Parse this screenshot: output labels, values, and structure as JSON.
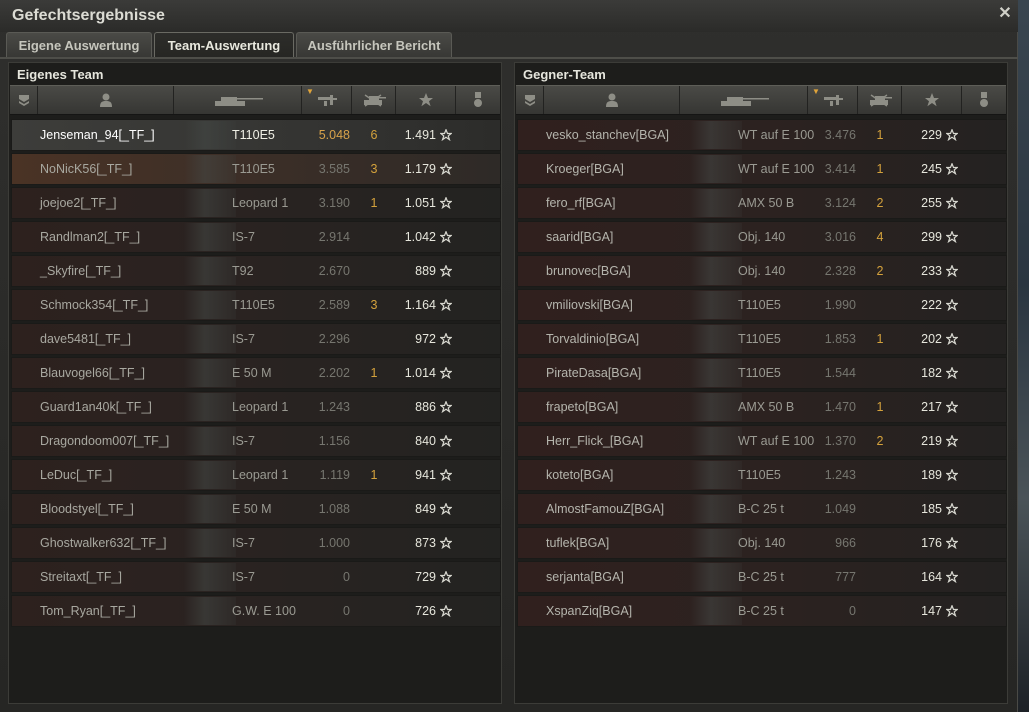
{
  "window": {
    "title": "Gefechtsergebnisse"
  },
  "tabs": [
    {
      "label": "Eigene Auswertung",
      "active": false
    },
    {
      "label": "Team-Auswertung",
      "active": true
    },
    {
      "label": "Ausführlicher Bericht",
      "active": false
    }
  ],
  "own_team": {
    "title": "Eigenes Team",
    "columns": [
      "squad-icon",
      "player-icon",
      "tank-icon",
      "xp-icon",
      "kills-icon",
      "star-icon",
      "medal-icon"
    ],
    "rows": [
      {
        "player": "Jenseman_94[_TF_]",
        "tank": "T110E5",
        "xp": "5.048",
        "kills": "6",
        "score": "1.491",
        "type": "self"
      },
      {
        "player": "NoNicK56[_TF_]",
        "tank": "T110E5",
        "xp": "3.585",
        "kills": "3",
        "score": "1.179",
        "type": "ally"
      },
      {
        "player": "joejoe2[_TF_]",
        "tank": "Leopard 1",
        "xp": "3.190",
        "kills": "1",
        "score": "1.051",
        "type": "normal"
      },
      {
        "player": "Randlman2[_TF_]",
        "tank": "IS-7",
        "xp": "2.914",
        "kills": "",
        "score": "1.042",
        "type": "normal"
      },
      {
        "player": "_Skyfire[_TF_]",
        "tank": "T92",
        "xp": "2.670",
        "kills": "",
        "score": "889",
        "type": "normal"
      },
      {
        "player": "Schmock354[_TF_]",
        "tank": "T110E5",
        "xp": "2.589",
        "kills": "3",
        "score": "1.164",
        "type": "normal"
      },
      {
        "player": "dave5481[_TF_]",
        "tank": "IS-7",
        "xp": "2.296",
        "kills": "",
        "score": "972",
        "type": "normal"
      },
      {
        "player": "Blauvogel66[_TF_]",
        "tank": "E 50 M",
        "xp": "2.202",
        "kills": "1",
        "score": "1.014",
        "type": "normal"
      },
      {
        "player": "Guard1an40k[_TF_]",
        "tank": "Leopard 1",
        "xp": "1.243",
        "kills": "",
        "score": "886",
        "type": "normal"
      },
      {
        "player": "Dragondoom007[_TF_]",
        "tank": "IS-7",
        "xp": "1.156",
        "kills": "",
        "score": "840",
        "type": "normal"
      },
      {
        "player": "LeDuc[_TF_]",
        "tank": "Leopard 1",
        "xp": "1.119",
        "kills": "1",
        "score": "941",
        "type": "normal"
      },
      {
        "player": "Bloodstyel[_TF_]",
        "tank": "E 50 M",
        "xp": "1.088",
        "kills": "",
        "score": "849",
        "type": "normal"
      },
      {
        "player": "Ghostwalker632[_TF_]",
        "tank": "IS-7",
        "xp": "1.000",
        "kills": "",
        "score": "873",
        "type": "normal"
      },
      {
        "player": "Streitaxt[_TF_]",
        "tank": "IS-7",
        "xp": "0",
        "kills": "",
        "score": "729",
        "type": "normal"
      },
      {
        "player": "Tom_Ryan[_TF_]",
        "tank": "G.W. E 100",
        "xp": "0",
        "kills": "",
        "score": "726",
        "type": "normal"
      }
    ]
  },
  "enemy_team": {
    "title": "Gegner-Team",
    "rows": [
      {
        "player": "vesko_stanchev[BGA]",
        "tank": "WT auf E 100",
        "xp": "3.476",
        "kills": "1",
        "score": "229"
      },
      {
        "player": "Kroeger[BGA]",
        "tank": "WT auf E 100",
        "xp": "3.414",
        "kills": "1",
        "score": "245"
      },
      {
        "player": "fero_rf[BGA]",
        "tank": "AMX 50 B",
        "xp": "3.124",
        "kills": "2",
        "score": "255"
      },
      {
        "player": "saarid[BGA]",
        "tank": "Obj. 140",
        "xp": "3.016",
        "kills": "4",
        "score": "299"
      },
      {
        "player": "brunovec[BGA]",
        "tank": "Obj. 140",
        "xp": "2.328",
        "kills": "2",
        "score": "233"
      },
      {
        "player": "vmiliovski[BGA]",
        "tank": "T110E5",
        "xp": "1.990",
        "kills": "",
        "score": "222"
      },
      {
        "player": "Torvaldinio[BGA]",
        "tank": "T110E5",
        "xp": "1.853",
        "kills": "1",
        "score": "202"
      },
      {
        "player": "PirateDasa[BGA]",
        "tank": "T110E5",
        "xp": "1.544",
        "kills": "",
        "score": "182"
      },
      {
        "player": "frapeto[BGA]",
        "tank": "AMX 50 B",
        "xp": "1.470",
        "kills": "1",
        "score": "217"
      },
      {
        "player": "Herr_Flick_[BGA]",
        "tank": "WT auf E 100",
        "xp": "1.370",
        "kills": "2",
        "score": "219"
      },
      {
        "player": "koteto[BGA]",
        "tank": "T110E5",
        "xp": "1.243",
        "kills": "",
        "score": "189"
      },
      {
        "player": "AlmostFamouZ[BGA]",
        "tank": "B-C 25 t",
        "xp": "1.049",
        "kills": "",
        "score": "185"
      },
      {
        "player": "tuflek[BGA]",
        "tank": "Obj. 140",
        "xp": "966",
        "kills": "",
        "score": "176"
      },
      {
        "player": "serjanta[BGA]",
        "tank": "B-C 25 t",
        "xp": "777",
        "kills": "",
        "score": "164"
      },
      {
        "player": "XspanZiq[BGA]",
        "tank": "B-C 25 t",
        "xp": "0",
        "kills": "",
        "score": "147"
      }
    ]
  },
  "colors": {
    "accent": "#d8a24a",
    "kills": "#d4a23c",
    "text": "#e6e6dc"
  }
}
